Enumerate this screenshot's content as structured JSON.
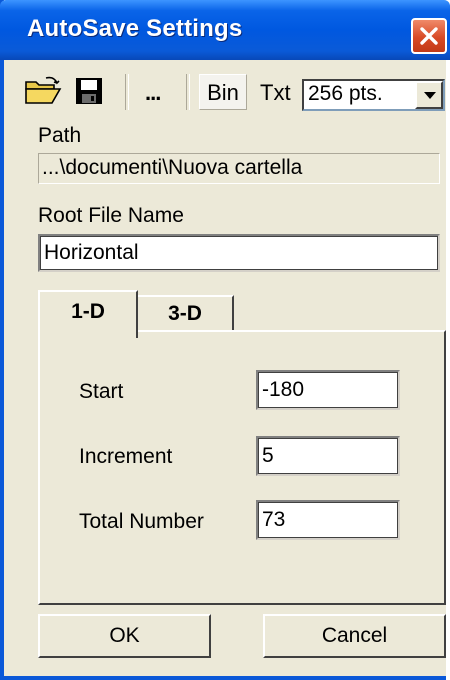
{
  "window": {
    "title": "AutoSave Settings"
  },
  "toolbar": {
    "open_icon": "folder-open-icon",
    "save_icon": "floppy-disk-icon",
    "browse_label": "...",
    "bin_label": "Bin",
    "txt_label": "Txt",
    "points_selected": "256 pts."
  },
  "path": {
    "label": "Path",
    "value": "...\\documenti\\Nuova cartella"
  },
  "root_file": {
    "label": "Root File Name",
    "value": "Horizontal"
  },
  "tabs": [
    {
      "label": "1-D",
      "active": true
    },
    {
      "label": "3-D",
      "active": false
    }
  ],
  "fields": {
    "start": {
      "label": "Start",
      "value": "-180"
    },
    "increment": {
      "label": "Increment",
      "value": "5"
    },
    "total_number": {
      "label": "Total Number",
      "value": "73"
    }
  },
  "buttons": {
    "ok": "OK",
    "cancel": "Cancel"
  },
  "colors": {
    "titlebar": "#0058e0",
    "window_bg": "#ece9d8",
    "close_button": "#d84a26"
  }
}
